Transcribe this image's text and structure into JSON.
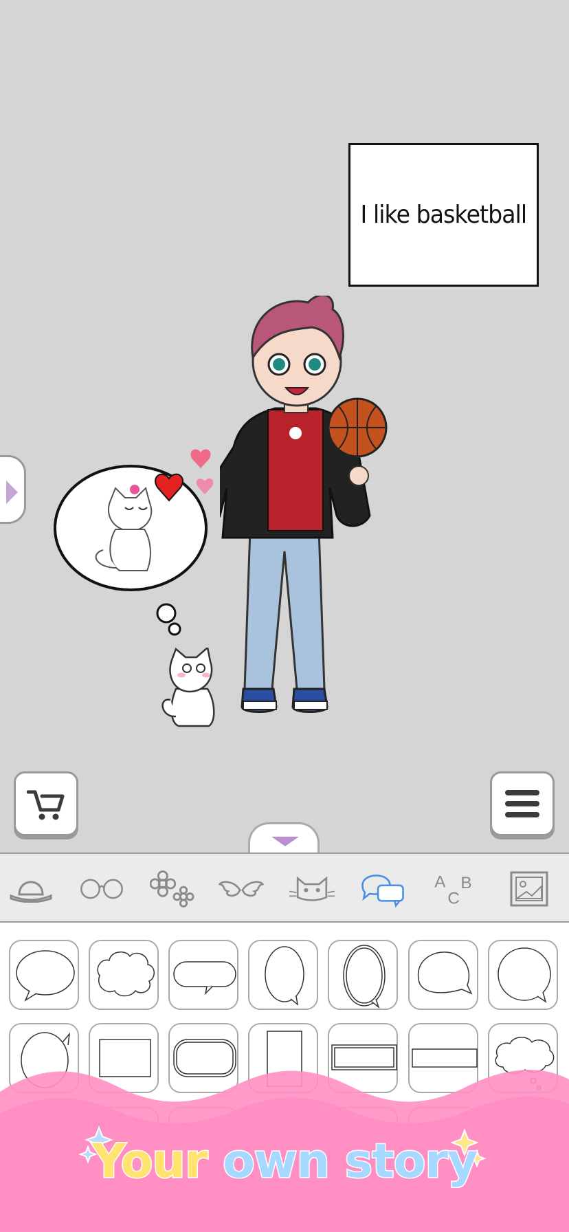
{
  "speech_bubble": {
    "text": "I like basketball"
  },
  "buttons": {
    "cart": "cart-icon",
    "menu": "hamburger-menu-icon",
    "side_tab": "chevron-right-icon",
    "drawer_toggle": "chevron-down-icon"
  },
  "categories": [
    {
      "name": "hat-icon",
      "selected": false
    },
    {
      "name": "glasses-icon",
      "selected": false
    },
    {
      "name": "flowers-icon",
      "selected": false
    },
    {
      "name": "wings-icon",
      "selected": false
    },
    {
      "name": "cat-icon",
      "selected": false
    },
    {
      "name": "speech-bubble-icon",
      "selected": true
    },
    {
      "name": "text-abc-icon",
      "selected": false,
      "label": "ABC"
    },
    {
      "name": "background-image-icon",
      "selected": false
    }
  ],
  "colors": {
    "selected": "#4a90e2",
    "icon": "#8a8a8a",
    "banner_pink": "#ff8fc3",
    "accent_purple": "#c4a4d6"
  },
  "banner": {
    "tagline_words": [
      "Your",
      "own",
      "story"
    ]
  }
}
